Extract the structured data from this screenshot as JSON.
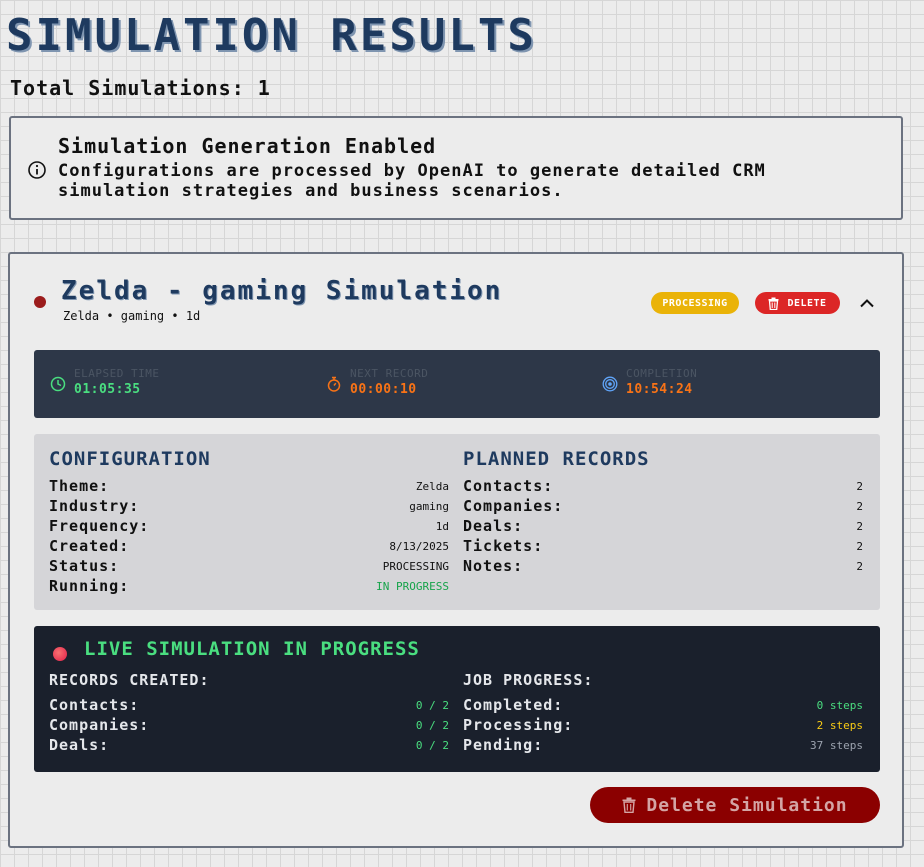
{
  "page": {
    "title": "SIMULATION RESULTS",
    "total_label": "Total Simulations: 1"
  },
  "info": {
    "icon": "info-icon",
    "title": "Simulation Generation Enabled",
    "text": "Configurations are processed by OpenAI to generate detailed CRM simulation strategies and business scenarios."
  },
  "simulation": {
    "title": "Zelda - gaming Simulation",
    "subtitle": "Zelda • gaming • 1d",
    "status_dot_color": "#9b1c1c",
    "status_badge": "PROCESSING",
    "delete_badge": "DELETE",
    "timers": [
      {
        "label": "ELAPSED TIME",
        "value": "01:05:35",
        "icon": "clock-icon",
        "color": "#4ade80"
      },
      {
        "label": "NEXT RECORD",
        "value": "00:00:10",
        "icon": "stopwatch-icon",
        "color": "#f97316"
      },
      {
        "label": "COMPLETION",
        "value": "10:54:24",
        "icon": "target-icon",
        "color": "#f97316"
      }
    ],
    "configuration": {
      "heading": "CONFIGURATION",
      "rows": [
        {
          "key": "Theme:",
          "value": "Zelda"
        },
        {
          "key": "Industry:",
          "value": "gaming"
        },
        {
          "key": "Frequency:",
          "value": "1d"
        },
        {
          "key": "Created:",
          "value": "8/13/2025"
        },
        {
          "key": "Status:",
          "value": "PROCESSING"
        },
        {
          "key": "Running:",
          "value": "IN PROGRESS"
        }
      ]
    },
    "planned": {
      "heading": "PLANNED RECORDS",
      "rows": [
        {
          "key": "Contacts:",
          "value": "2"
        },
        {
          "key": "Companies:",
          "value": "2"
        },
        {
          "key": "Deals:",
          "value": "2"
        },
        {
          "key": "Tickets:",
          "value": "2"
        },
        {
          "key": "Notes:",
          "value": "2"
        }
      ]
    },
    "live": {
      "title": "LIVE SIMULATION IN PROGRESS",
      "records_heading": "RECORDS CREATED:",
      "records": [
        {
          "key": "Contacts:",
          "value": "0 / 2"
        },
        {
          "key": "Companies:",
          "value": "0 / 2"
        },
        {
          "key": "Deals:",
          "value": "0 / 2"
        }
      ],
      "job_heading": "JOB PROGRESS:",
      "job": [
        {
          "key": "Completed:",
          "value": "0 steps",
          "color": "#4ade80"
        },
        {
          "key": "Processing:",
          "value": "2 steps",
          "color": "#facc15"
        },
        {
          "key": "Pending:",
          "value": "37 steps",
          "color": "#9ca3af"
        }
      ]
    },
    "delete_button": "Delete Simulation",
    "colors": {
      "accent": "#1e3a5f",
      "in_progress": "#16a34a",
      "live_green": "#4ade80",
      "delete_red": "#dc2626"
    }
  }
}
